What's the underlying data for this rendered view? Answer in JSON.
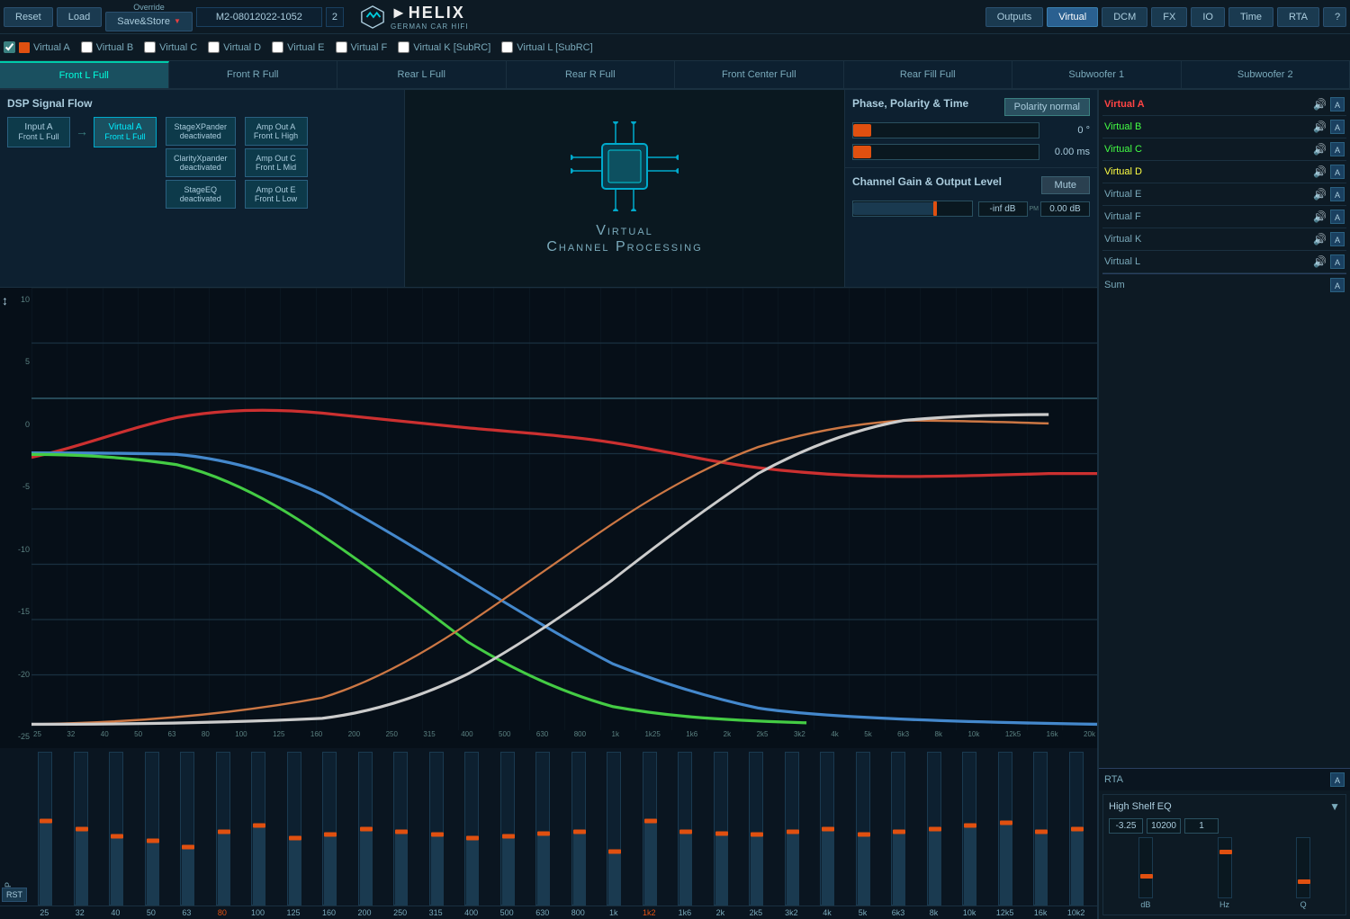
{
  "topBar": {
    "resetLabel": "Reset",
    "loadLabel": "Load",
    "overrideLabel": "Override",
    "saveStoreLabel": "Save&Store",
    "deviceName": "M2-08012022-1052",
    "deviceNum": "2",
    "navItems": [
      "Outputs",
      "Virtual",
      "DCM",
      "FX",
      "IO",
      "Time",
      "RTA"
    ],
    "activeNav": "Virtual",
    "helpLabel": "?"
  },
  "virtualRow": {
    "items": [
      {
        "label": "Virtual A",
        "color": "#e05010",
        "checked": true
      },
      {
        "label": "Virtual B",
        "color": "#333",
        "checked": false
      },
      {
        "label": "Virtual C",
        "color": "#333",
        "checked": false
      },
      {
        "label": "Virtual D",
        "color": "#333",
        "checked": false
      },
      {
        "label": "Virtual E",
        "color": "#333",
        "checked": false
      },
      {
        "label": "Virtual F",
        "color": "#333",
        "checked": false
      },
      {
        "label": "Virtual K [SubRC]",
        "color": "#333",
        "checked": false
      },
      {
        "label": "Virtual L [SubRC]",
        "color": "#333",
        "checked": false
      }
    ]
  },
  "channelTabs": [
    "Front L Full",
    "Front R Full",
    "Rear L Full",
    "Rear R Full",
    "Front Center Full",
    "Rear Fill Full",
    "Subwoofer 1",
    "Subwoofer 2"
  ],
  "activeChannelTab": 0,
  "dspFlow": {
    "title": "DSP Signal Flow",
    "inputNode": "Input A\nFront L Full",
    "virtualNode": "Virtual A\nFront L Full",
    "middleNodes": [
      "StageXPander\ndeactivated",
      "ClarityXpander\ndeactivated",
      "StageEQ\ndeactivated"
    ],
    "outputNodes": [
      "Amp Out A\nFront L High",
      "Amp Out C\nFront L Mid",
      "Amp Out E\nFront L Low"
    ]
  },
  "vcpTitle": "Virtual\nChannel Processing",
  "phasePanel": {
    "title": "Phase, Polarity & Time",
    "polarityLabel": "Polarity normal",
    "slider1Value": "0 °",
    "slider2Value": "0.00 ms"
  },
  "gainPanel": {
    "title": "Channel Gain & Output Level",
    "muteLabel": "Mute",
    "gainValue": "-inf dB",
    "gainValue2": "0.00 dB"
  },
  "eqGraph": {
    "yLabels": [
      "10",
      "5",
      "0",
      "-5",
      "-10",
      "-15",
      "-20",
      "-25"
    ],
    "xLabels": [
      "25",
      "32",
      "40",
      "50",
      "63",
      "80",
      "100",
      "125",
      "160",
      "200",
      "250",
      "315",
      "400",
      "500",
      "630",
      "800",
      "1k",
      "1k25",
      "1k6",
      "2k",
      "2k5",
      "3k2",
      "4k",
      "5k",
      "6k3",
      "8k",
      "10k",
      "12k5",
      "16k",
      "20k"
    ]
  },
  "faderLabels": [
    "25",
    "32",
    "40",
    "50",
    "63",
    "80",
    "100",
    "125",
    "160",
    "200",
    "250",
    "315",
    "400",
    "500",
    "630",
    "800",
    "1k",
    "1k2",
    "1k6",
    "2k",
    "2k5",
    "3k2",
    "4k",
    "5k",
    "6k3",
    "8k",
    "10k",
    "12k5",
    "16k",
    "10k2"
  ],
  "activeFaders": [
    5,
    17
  ],
  "rstLabel": "RST",
  "bypLabel": "BYP",
  "highShelf": {
    "title": "High Shelf EQ",
    "dbValue": "-3.25",
    "hzValue": "10200",
    "qValue": "1",
    "faderLabels": [
      "dB",
      "Hz",
      "Q"
    ]
  },
  "sidebar": {
    "items": [
      {
        "name": "Virtual A",
        "color": "active"
      },
      {
        "name": "Virtual B",
        "color": "green"
      },
      {
        "name": "Virtual C",
        "color": "green"
      },
      {
        "name": "Virtual D",
        "color": "yellow"
      },
      {
        "name": "Virtual E",
        "color": "normal"
      },
      {
        "name": "Virtual F",
        "color": "normal"
      },
      {
        "name": "Virtual K",
        "color": "normal"
      },
      {
        "name": "Virtual L",
        "color": "normal"
      }
    ],
    "sumLabel": "Sum",
    "rtaLabel": "RTA"
  }
}
